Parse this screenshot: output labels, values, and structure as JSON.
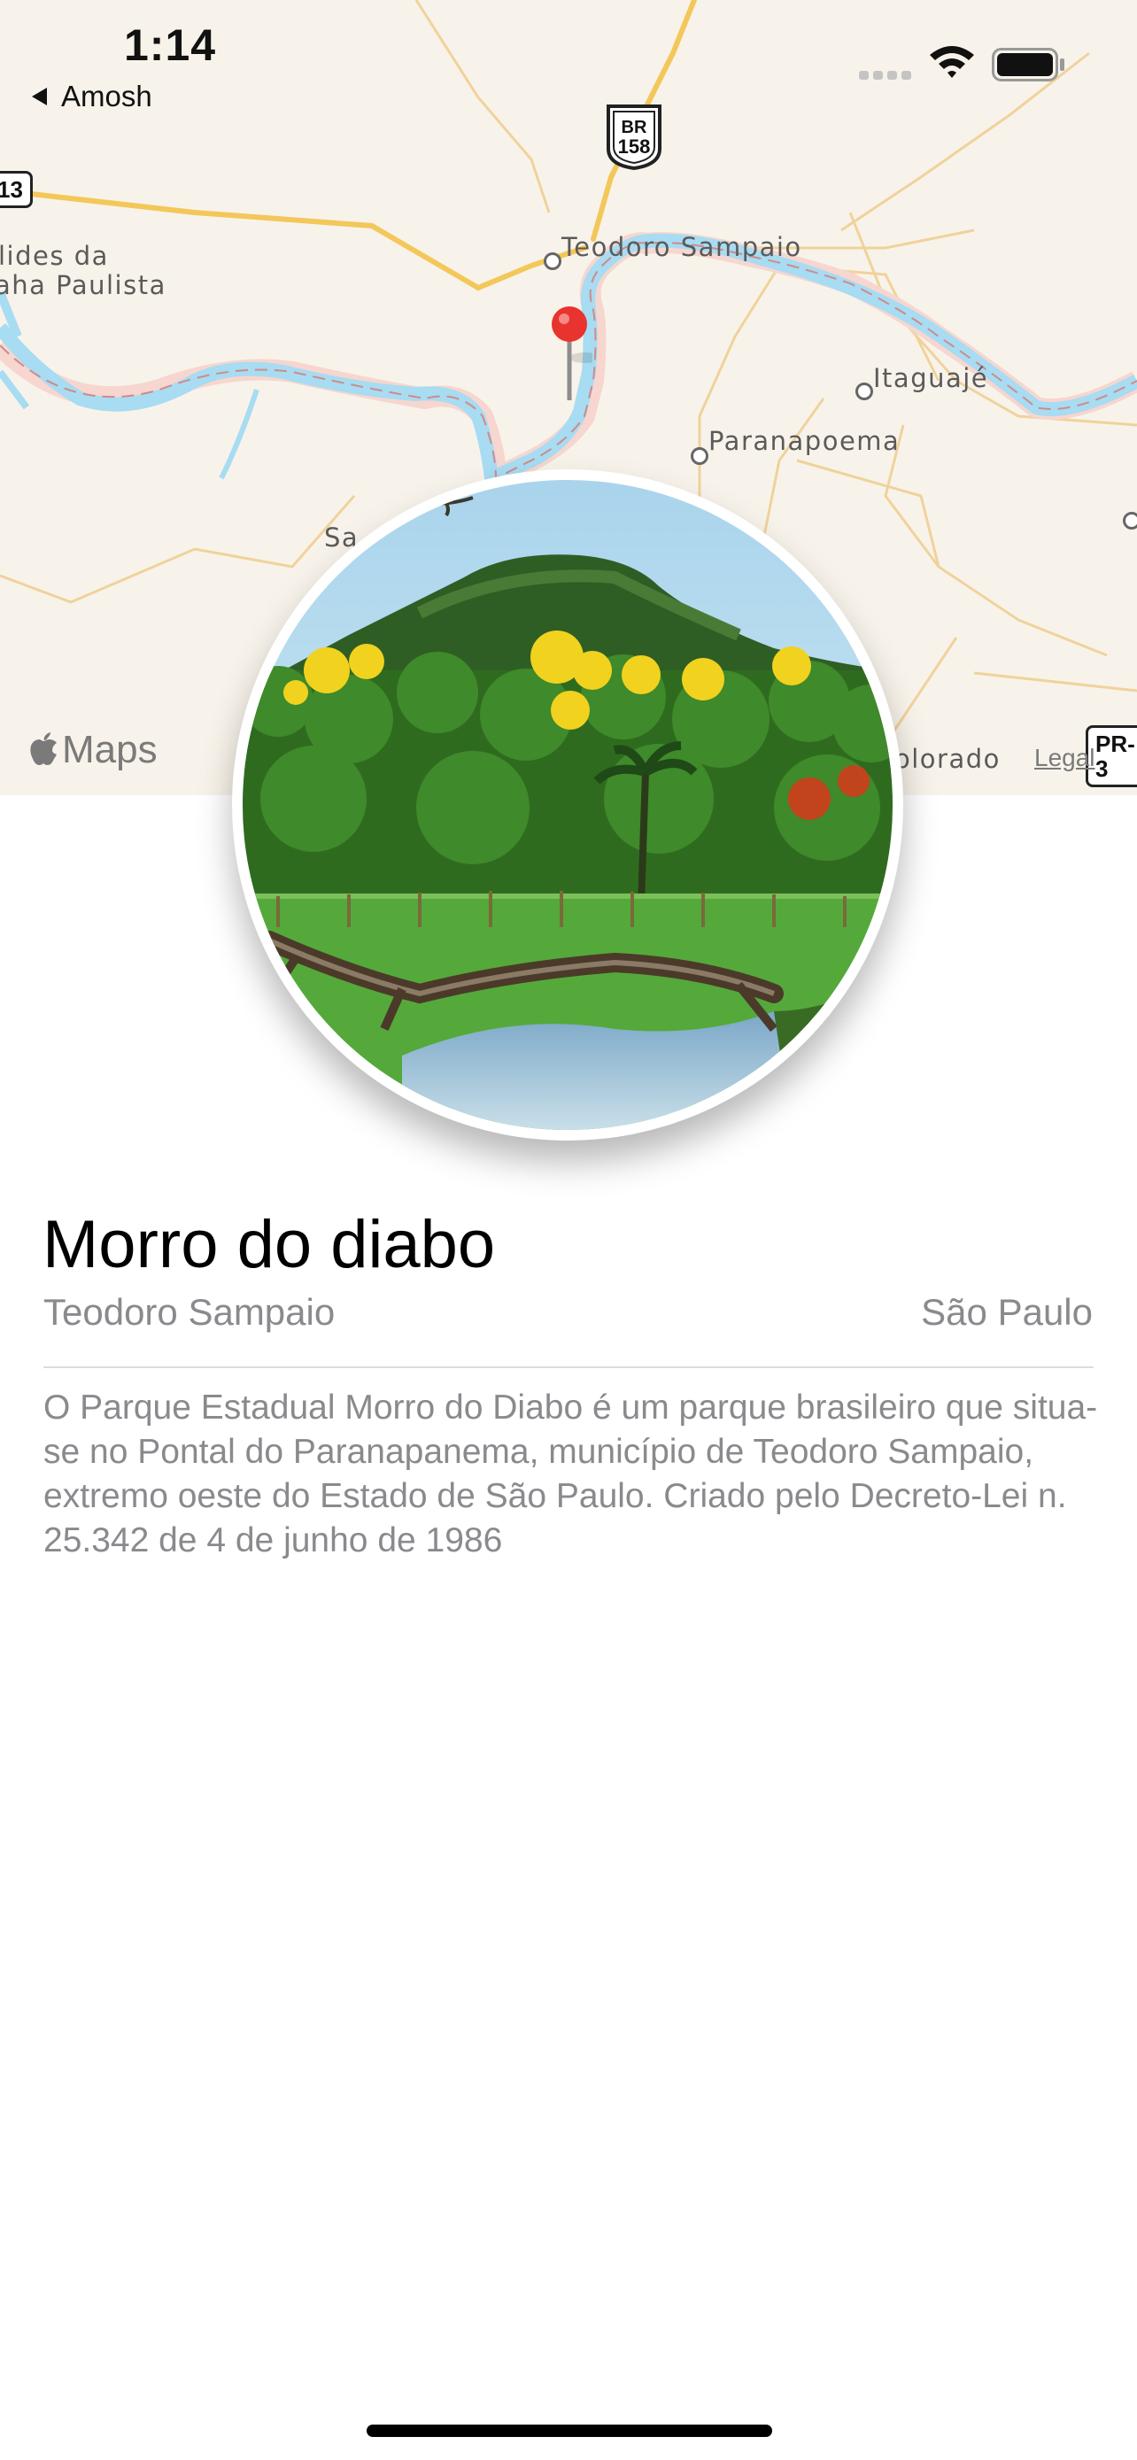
{
  "status_bar": {
    "time": "1:14",
    "back_label": "Amosh"
  },
  "map": {
    "labels": {
      "teodoro": "Teodoro Sampaio",
      "itaguaje": "Itaguajé",
      "paranapoema": "Paranapoema",
      "lides": "lides da",
      "paulista": "aha Paulista",
      "sa": "Sa",
      "colorado": "olorado"
    },
    "routes": {
      "br_top": "BR",
      "br_num": "158",
      "left_tag": "13",
      "right_tag": "PR-3"
    },
    "brand": "Maps",
    "legal": "Legal",
    "colors": {
      "river": "#a7dcf2",
      "road": "#f3c75a",
      "pin": "#e8332e"
    }
  },
  "place": {
    "title": "Morro do diabo",
    "city": "Teodoro Sampaio",
    "state": "São Paulo",
    "description": "O Parque Estadual Morro do Diabo é um parque brasileiro que situa-se no Pontal do Paranapanema, município de Teodoro Sampaio, extremo oeste do Estado de São Paulo. Criado pelo Decreto-Lei n. 25.342 de 4 de junho de 1986"
  }
}
